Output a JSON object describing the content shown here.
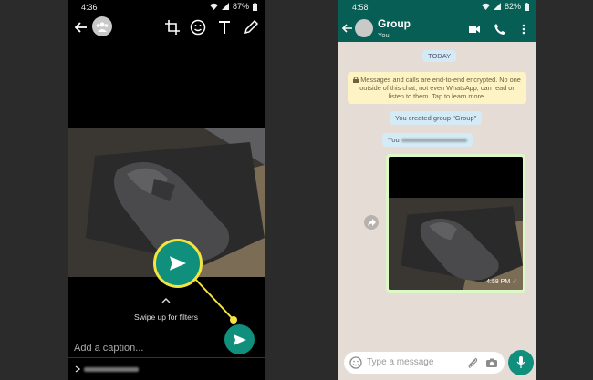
{
  "left_phone": {
    "status": {
      "time": "4:36",
      "battery": "87%"
    },
    "tools": [
      "crop-rotate-icon",
      "emoji-icon",
      "text-icon",
      "pencil-icon"
    ],
    "hint": "Swipe up for filters",
    "caption_placeholder": "Add a caption...",
    "recipients": "Recipient name"
  },
  "right_phone": {
    "status": {
      "time": "4:58",
      "battery": "82%"
    },
    "header": {
      "title": "Group",
      "subtitle": "You"
    },
    "date_chip": "TODAY",
    "encryption_notice": "Messages and calls are end-to-end encrypted. No one outside of this chat, not even WhatsApp, can read or listen to them. Tap to learn more.",
    "system_created": "You created group \"Group\"",
    "system_added_prefix": "You",
    "image_time": "4:58 PM ✓",
    "input_placeholder": "Type a message"
  },
  "colors": {
    "whatsapp_green": "#075e54",
    "fab_teal": "#0f8f7c",
    "highlight_yellow": "#f4e440",
    "outgoing_bubble": "#dcf8c6"
  }
}
